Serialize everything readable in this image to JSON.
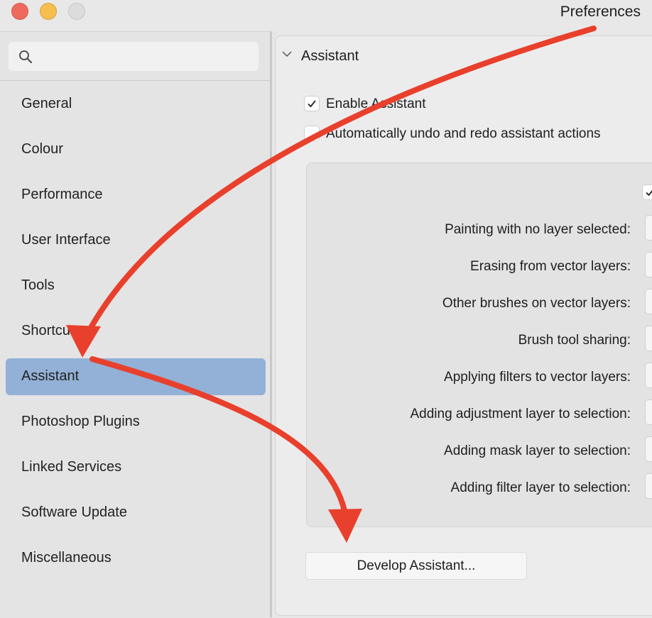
{
  "window": {
    "title": "Preferences"
  },
  "search": {
    "placeholder": "",
    "value": ""
  },
  "sidebar": {
    "items": [
      {
        "label": "General"
      },
      {
        "label": "Colour"
      },
      {
        "label": "Performance"
      },
      {
        "label": "User Interface"
      },
      {
        "label": "Tools"
      },
      {
        "label": "Shortcuts"
      },
      {
        "label": "Assistant",
        "selected": true
      },
      {
        "label": "Photoshop Plugins"
      },
      {
        "label": "Linked Services"
      },
      {
        "label": "Software Update"
      },
      {
        "label": "Miscellaneous"
      }
    ]
  },
  "panel": {
    "section_title": "Assistant",
    "enable_assistant": {
      "label": "Enable Assistant",
      "checked": true
    },
    "auto_undo": {
      "label": "Automatically undo and redo assistant actions",
      "checked": false
    },
    "inner_checkbox_checked": true,
    "options": [
      {
        "label": "Painting with no layer selected:"
      },
      {
        "label": "Erasing from vector layers:"
      },
      {
        "label": "Other brushes on vector layers:"
      },
      {
        "label": "Brush tool sharing:"
      },
      {
        "label": "Applying filters to vector layers:"
      },
      {
        "label": "Adding adjustment layer to selection:"
      },
      {
        "label": "Adding mask layer to selection:"
      },
      {
        "label": "Adding filter layer to selection:"
      }
    ],
    "develop_button": "Develop Assistant..."
  },
  "colors": {
    "selection": "#93b1d7",
    "annotation_arrow": "#e8402c",
    "close": "#ee6a5e",
    "minimize": "#f5be4f"
  },
  "icons": [
    "search-icon",
    "chevron-down-icon",
    "checkmark-icon"
  ]
}
